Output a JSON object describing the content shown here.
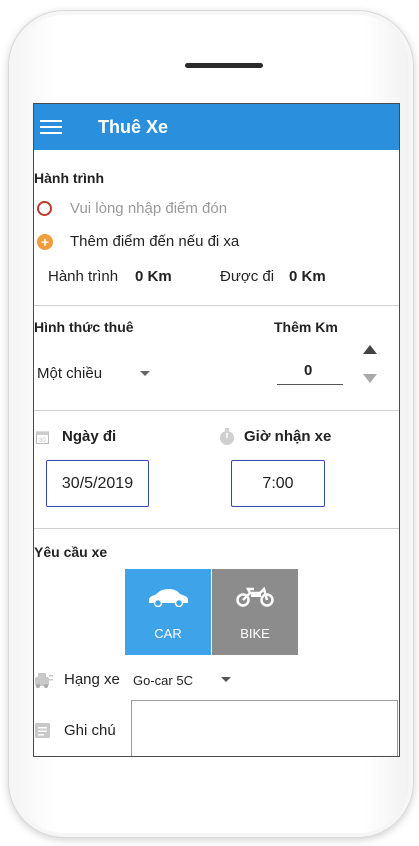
{
  "app": {
    "title": "Thuê Xe"
  },
  "journey": {
    "section_title": "Hành trình",
    "pickup_placeholder": "Vui lòng nhập điểm đón",
    "add_destination": "Thêm điểm đến nếu đi xa",
    "distance_label": "Hành trình",
    "distance_value": "0 Km",
    "allowed_label": "Được đi",
    "allowed_value": "0 Km"
  },
  "rental": {
    "section_title": "Hình thức thuê",
    "extra_km_title": "Thêm Km",
    "type_value": "Một chiều",
    "extra_km_value": "0"
  },
  "datetime": {
    "date_label": "Ngày đi",
    "date_value": "30/5/2019",
    "time_label": "Giờ nhận xe",
    "time_value": "7:00"
  },
  "vehicle": {
    "section_title": "Yêu cầu xe",
    "car_label": "CAR",
    "bike_label": "BIKE",
    "class_label": "Hạng xe",
    "class_value": "Go-car 5C",
    "note_label": "Ghi chú"
  },
  "colors": {
    "primary": "#2a8fdc",
    "car_selected": "#3fa3ea",
    "bike_unselected": "#8c8c8c"
  }
}
